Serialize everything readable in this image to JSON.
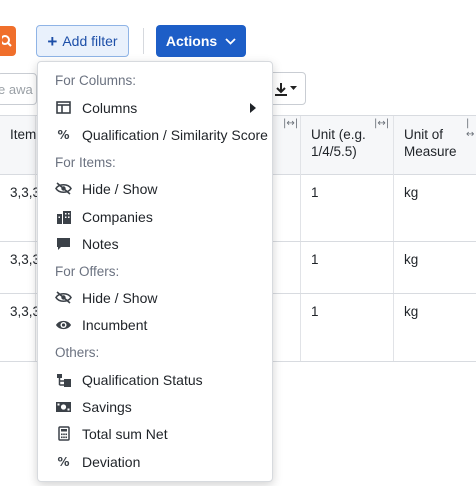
{
  "toolbar": {
    "add_filter_label": "Add filter",
    "actions_label": "Actions"
  },
  "search": {
    "placeholder": "e awa"
  },
  "table": {
    "headers": [
      "Item",
      "Unit (e.g. 1/4/5.5)",
      "Unit of Measure"
    ],
    "rows": [
      {
        "item": "3,3,3",
        "unit": "1",
        "uom": "kg"
      },
      {
        "item": "3,3,3",
        "unit": "1",
        "uom": "kg"
      },
      {
        "item": "3,3,3",
        "unit": "1",
        "uom": "kg"
      }
    ]
  },
  "menu": {
    "sections": {
      "columns": "For Columns:",
      "items": "For Items:",
      "offers": "For Offers:",
      "others": "Others:"
    },
    "items": {
      "columns": "Columns",
      "qualification_score": "Qualification / Similarity Score",
      "items_hide_show": "Hide / Show",
      "companies": "Companies",
      "notes": "Notes",
      "offers_hide_show": "Hide / Show",
      "incumbent": "Incumbent",
      "qualification_status": "Qualification Status",
      "savings": "Savings",
      "total_sum_net": "Total sum Net",
      "deviation": "Deviation"
    }
  },
  "colors": {
    "primary": "#1d5ec7",
    "search_orange": "#f06f2b",
    "filter_bg": "#e9f1fc"
  }
}
